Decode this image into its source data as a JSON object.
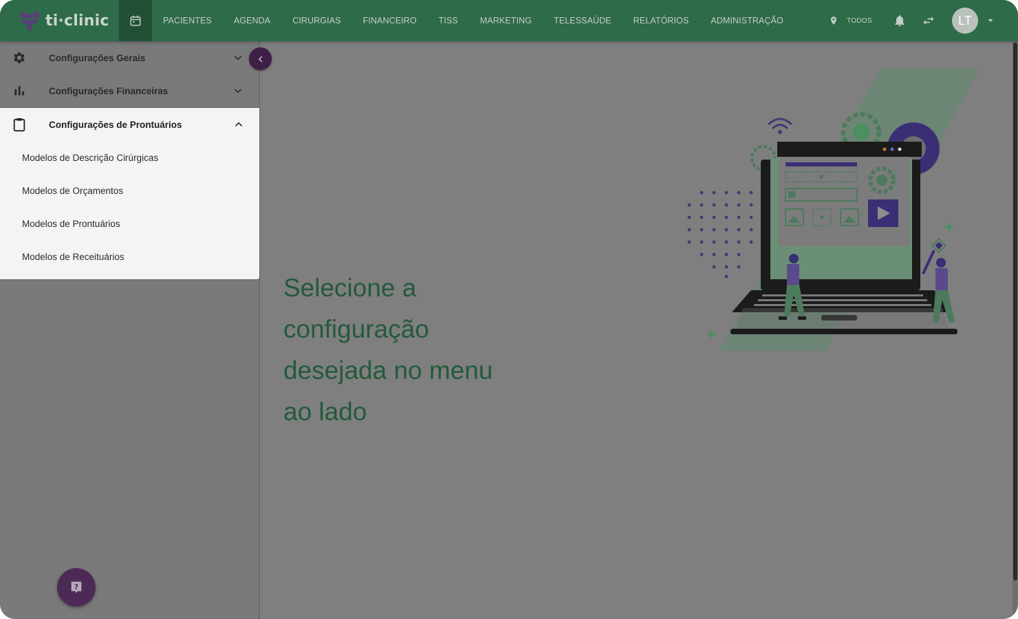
{
  "app": {
    "logo_text": "ti·clinic"
  },
  "nav": {
    "items": [
      {
        "label": "PACIENTES"
      },
      {
        "label": "AGENDA"
      },
      {
        "label": "CIRURGIAS"
      },
      {
        "label": "FINANCEIRO"
      },
      {
        "label": "TISS"
      },
      {
        "label": "MARKETING"
      },
      {
        "label": "TELESSAÚDE"
      },
      {
        "label": "RELATÓRIOS"
      },
      {
        "label": "ADMINISTRAÇÃO"
      }
    ]
  },
  "topbar": {
    "location_label": "TODOS",
    "avatar_initials": "LT",
    "icons": [
      "calendar-icon",
      "location-pin-icon",
      "bell-icon",
      "swap-icon",
      "caret-down-icon"
    ]
  },
  "sidebar": {
    "sections": [
      {
        "label": "Configurações Gerais",
        "icon": "gear-icon",
        "expanded": false
      },
      {
        "label": "Configurações Financeiras",
        "icon": "bar-chart-icon",
        "expanded": false
      },
      {
        "label": "Configurações de Prontuários",
        "icon": "clipboard-icon",
        "expanded": true,
        "items": [
          {
            "label": "Modelos de Descrição Cirúrgicas"
          },
          {
            "label": "Modelos de Orçamentos"
          },
          {
            "label": "Modelos de Prontuários"
          },
          {
            "label": "Modelos de Receituários"
          }
        ]
      }
    ]
  },
  "main": {
    "headline": "Selecione a configuração desejada no menu ao lado"
  },
  "colors": {
    "topbar": "#2e6b48",
    "accent_purple": "#3e1f46",
    "headline_green": "#245a3c",
    "overlay_gray": "#7f7f7f"
  }
}
